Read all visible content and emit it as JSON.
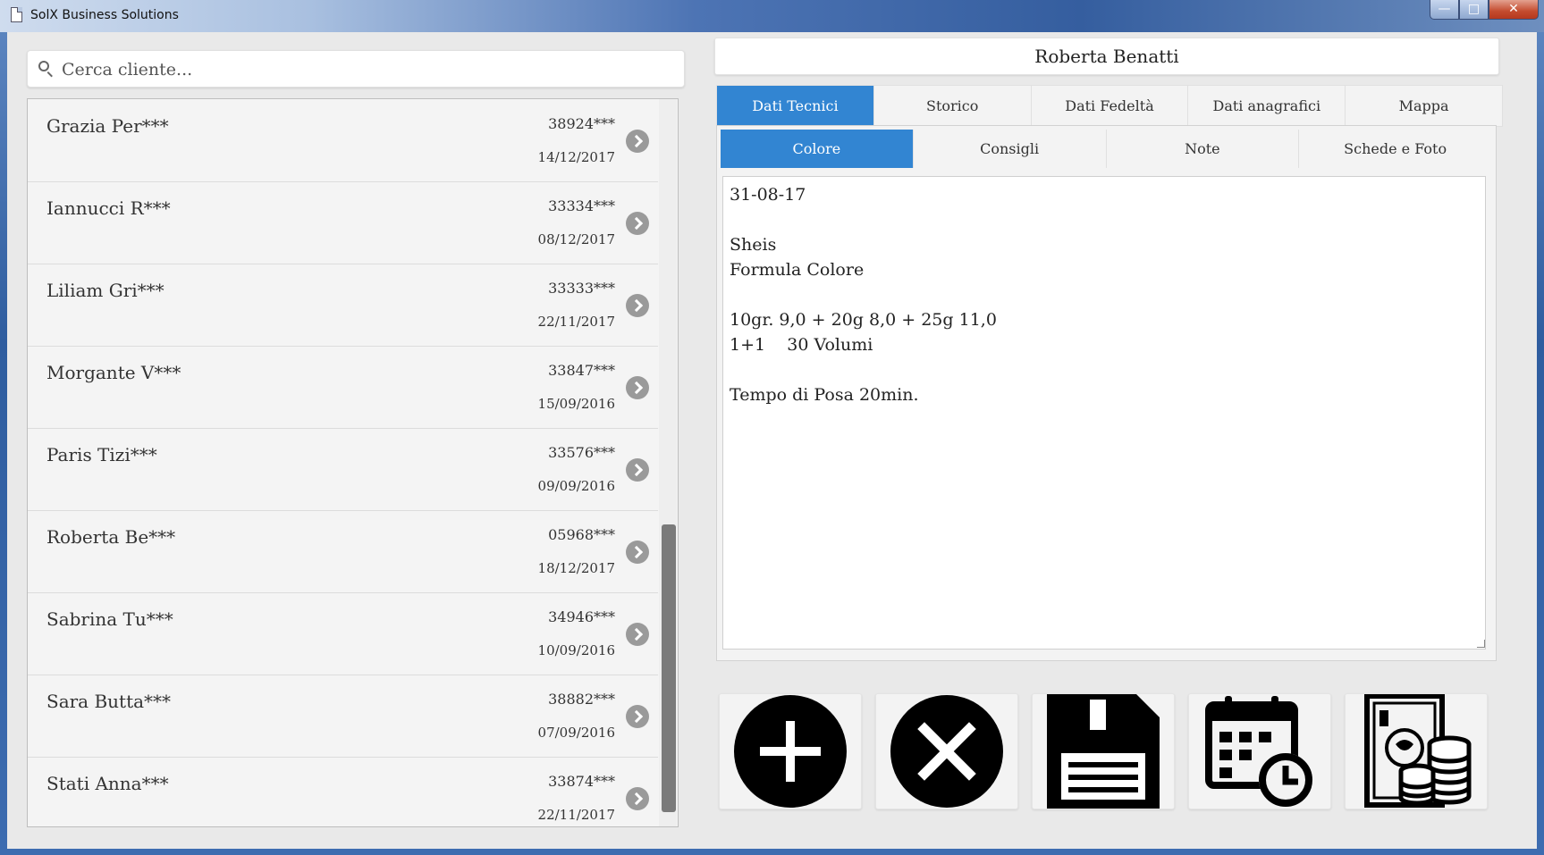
{
  "window": {
    "title": "SolX Business Solutions",
    "minimize_glyph": "—",
    "maximize_glyph": "□",
    "close_glyph": "✕"
  },
  "search": {
    "placeholder": "Cerca cliente..."
  },
  "clients": [
    {
      "name": "Grazia Per***",
      "phone": "38924***",
      "date": "14/12/2017"
    },
    {
      "name": "Iannucci R***",
      "phone": "33334***",
      "date": "08/12/2017"
    },
    {
      "name": "Liliam Gri***",
      "phone": "33333***",
      "date": "22/11/2017"
    },
    {
      "name": "Morgante V***",
      "phone": "33847***",
      "date": "15/09/2016"
    },
    {
      "name": "Paris Tizi***",
      "phone": "33576***",
      "date": "09/09/2016"
    },
    {
      "name": "Roberta Be***",
      "phone": "05968***",
      "date": "18/12/2017"
    },
    {
      "name": "Sabrina Tu***",
      "phone": "34946***",
      "date": "10/09/2016"
    },
    {
      "name": "Sara Butta***",
      "phone": "38882***",
      "date": "07/09/2016"
    },
    {
      "name": "Stati Anna***",
      "phone": "33874***",
      "date": "22/11/2017"
    }
  ],
  "customer": {
    "name": "Roberta Benatti"
  },
  "tabs": [
    "Dati Tecnici",
    "Storico",
    "Dati Fedeltà",
    "Dati anagrafici",
    "Mappa"
  ],
  "active_tab": "Dati Tecnici",
  "subtabs": [
    "Colore",
    "Consigli",
    "Note",
    "Schede e Foto"
  ],
  "active_subtab": "Colore",
  "notes_text": "31-08-17\n\nSheis\nFormula Colore\n\n10gr. 9,0 + 20g 8,0 + 25g 11,0\n1+1    30 Volumi\n\nTempo di Posa 20min.",
  "actions": [
    {
      "name": "add",
      "icon": "plus-circle-icon"
    },
    {
      "name": "cancel",
      "icon": "x-circle-icon"
    },
    {
      "name": "save",
      "icon": "floppy-disk-icon"
    },
    {
      "name": "appointment",
      "icon": "calendar-clock-icon"
    },
    {
      "name": "payment",
      "icon": "money-coins-icon"
    }
  ],
  "colors": {
    "accent": "#3285d2",
    "panel": "#f3f3f3",
    "background": "#e9e9e9"
  }
}
